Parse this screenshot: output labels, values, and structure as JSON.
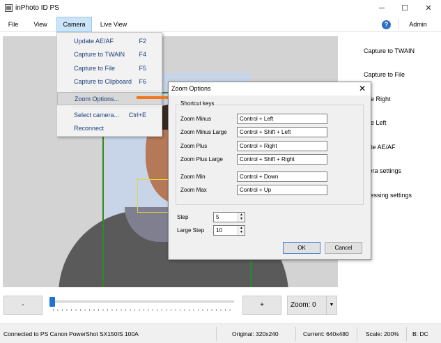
{
  "window": {
    "title": "inPhoto ID PS",
    "minimize_glyph": "─",
    "maximize_glyph": "☐",
    "close_glyph": "✕"
  },
  "menubar": {
    "items": [
      "File",
      "View",
      "Camera",
      "Live View"
    ],
    "help_glyph": "?",
    "admin_label": "Admin"
  },
  "camera_menu": {
    "items": [
      {
        "label": "Update AE/AF",
        "shortcut": "F2"
      },
      {
        "label": "Capture to TWAIN",
        "shortcut": "F4"
      },
      {
        "label": "Capture to File",
        "shortcut": "F5"
      },
      {
        "label": "Capture to Clipboard",
        "shortcut": "F6"
      },
      {
        "label": "Zoom Options...",
        "shortcut": ""
      },
      {
        "label": "Select camera...",
        "shortcut": "Ctrl+E"
      },
      {
        "label": "Reconnect",
        "shortcut": ""
      }
    ]
  },
  "right_panel": {
    "items": [
      "Capture to TWAIN",
      "Capture to File",
      "tate Right",
      "tate Left",
      "date AE/AF",
      "mera settings",
      "ocessing settings"
    ]
  },
  "zoom_dialog": {
    "title": "Zoom Options",
    "close_glyph": "✕",
    "group_title": "Shortcut keys",
    "shortcuts": [
      {
        "label": "Zoom Minus",
        "value": "Control + Left"
      },
      {
        "label": "Zoom Minus Large",
        "value": "Control + Shift + Left"
      },
      {
        "label": "Zoom Plus",
        "value": "Control + Right"
      },
      {
        "label": "Zoom Plus Large",
        "value": "Control + Shift + Right"
      },
      {
        "label": "Zoom Min",
        "value": "Control + Down"
      },
      {
        "label": "Zoom Max",
        "value": "Control + Up"
      }
    ],
    "step_label": "Step",
    "step_value": "5",
    "large_step_label": "Large Step",
    "large_step_value": "10",
    "ok_label": "OK",
    "cancel_label": "Cancel"
  },
  "controls": {
    "minus_label": "-",
    "plus_label": "+",
    "zoom_label": "Zoom: 0",
    "zoom_dropdown_glyph": "▼",
    "slider_position_fraction": 0.0
  },
  "statusbar": {
    "connection": "Connected to PS Canon PowerShot SX150IS 100A",
    "original": "Original: 320x240",
    "current": "Current: 640x480",
    "scale": "Scale: 200%",
    "extra": "B: DC"
  },
  "colors": {
    "accent": "#1e73d2",
    "arrow": "#f07820",
    "face_frame": "#2b8a2b"
  }
}
